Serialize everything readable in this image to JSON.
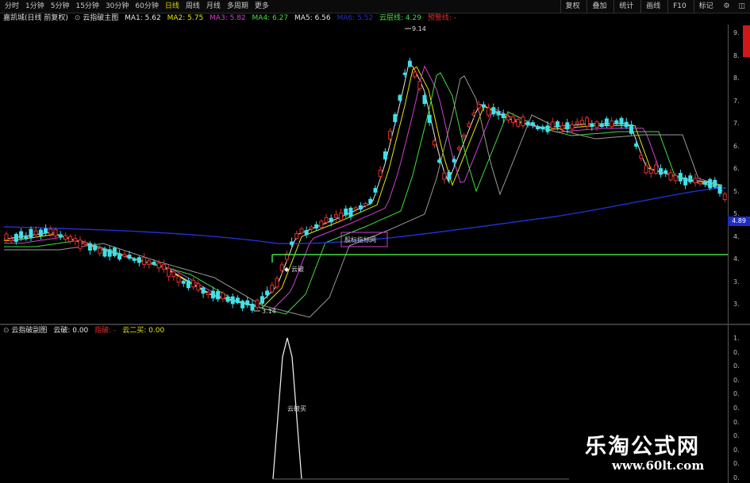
{
  "toolbar": {
    "timeframes": [
      "分时",
      "1分钟",
      "5分钟",
      "15分钟",
      "30分钟",
      "60分钟",
      "日线",
      "周线",
      "月线",
      "多周期",
      "更多"
    ],
    "active_timeframe": "日线",
    "right_buttons": [
      "复权",
      "叠加",
      "统计",
      "画线",
      "F10",
      "标记"
    ]
  },
  "main_header": {
    "stock": "嘉凯城(日线 前复权)",
    "indicator": "云指破主图",
    "ma1_label": "MA1:",
    "ma1": "5.62",
    "ma2_label": "MA2:",
    "ma2": "5.75",
    "ma3_label": "MA3:",
    "ma3": "5.82",
    "ma4_label": "MA4:",
    "ma4": "6.27",
    "ma5_label": "MA5:",
    "ma5": "6.56",
    "ma6_label": "MA6:",
    "ma6": "5.52",
    "cloud_line_label": "云层线:",
    "cloud_line": "4.29",
    "alert_line_label": "预警线:",
    "alert_line": "-"
  },
  "colors": {
    "up": "#e03030",
    "down": "#40e0e8",
    "ma1": "#e8e8e8",
    "ma2": "#e8e800",
    "ma3": "#d040d0",
    "ma4": "#40e040",
    "ma5": "#9a9a9a",
    "ma6": "#2030d0",
    "cloud": "#40e040",
    "alert": "#e03030",
    "current_price_bg": "#1c2ec8"
  },
  "axis": {
    "ticks": [
      "9.",
      "8.",
      "8.",
      "7.",
      "7.",
      "6.",
      "6.",
      "5.",
      "5.",
      "4.",
      "4.",
      "3.",
      "3."
    ],
    "current_price": "4.89"
  },
  "annotations": {
    "high": "9.14",
    "low": "3.14",
    "signal": "云破",
    "box_label": "股标指标网"
  },
  "sub_header": {
    "indicator": "云指破副图",
    "v1_label": "云破:",
    "v1": "0.00",
    "v2_label": "指破:",
    "v2": "-",
    "v3_label": "云二买:",
    "v3": "0.00"
  },
  "sub_axis": {
    "ticks": [
      "1.",
      "0.",
      "0.",
      "0.",
      "0.",
      "0.",
      "0.",
      "0.",
      "0.",
      "0.",
      "0."
    ]
  },
  "sub_annotation": "云破买",
  "watermark": {
    "title": "乐淘公式网",
    "url": "www.60lt.com"
  }
}
